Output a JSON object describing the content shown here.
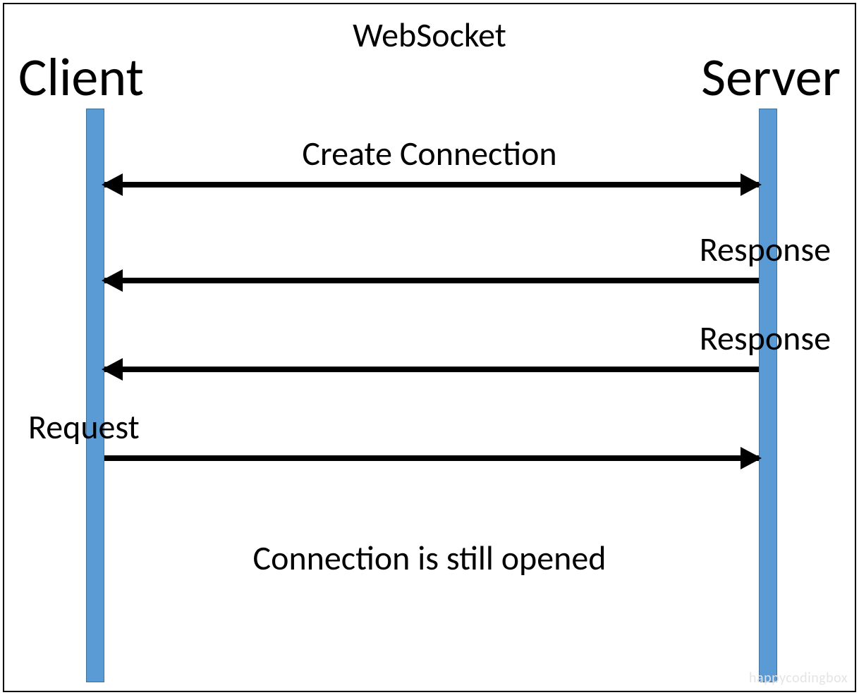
{
  "title": "WebSocket",
  "client_label": "Client",
  "server_label": "Server",
  "arrows": {
    "create_connection": "Create Connection",
    "response1": "Response",
    "response2": "Response",
    "request": "Request"
  },
  "footer": "Connection is still opened",
  "watermark": "happycodingbox",
  "colors": {
    "lifeline_fill": "#5b9bd5",
    "lifeline_border": "#41719c",
    "arrow": "#000000",
    "text": "#000000"
  }
}
